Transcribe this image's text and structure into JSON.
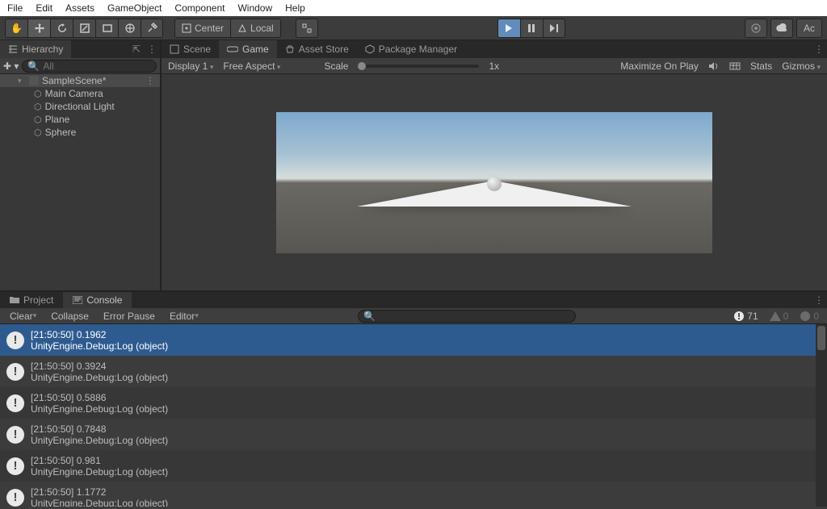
{
  "menubar": [
    "File",
    "Edit",
    "Assets",
    "GameObject",
    "Component",
    "Window",
    "Help"
  ],
  "toolbar": {
    "pivot": "Center",
    "handle": "Local",
    "account": "Ac"
  },
  "hierarchy": {
    "title": "Hierarchy",
    "search_placeholder": "All",
    "scene": "SampleScene*",
    "items": [
      "Main Camera",
      "Directional Light",
      "Plane",
      "Sphere"
    ]
  },
  "game_tabs": {
    "scene": "Scene",
    "game": "Game",
    "asset_store": "Asset Store",
    "package_manager": "Package Manager"
  },
  "game_bar": {
    "display": "Display 1",
    "aspect": "Free Aspect",
    "scale_label": "Scale",
    "scale_value": "1x",
    "maximize": "Maximize On Play",
    "stats": "Stats",
    "gizmos": "Gizmos"
  },
  "project_tabs": {
    "project": "Project",
    "console": "Console"
  },
  "console_bar": {
    "clear": "Clear",
    "collapse": "Collapse",
    "error_pause": "Error Pause",
    "editor": "Editor",
    "err_count": "71",
    "warn_count": "0",
    "info_count": "0"
  },
  "console_logs": [
    {
      "line1": "[21:50:50] 0.1962",
      "line2": "UnityEngine.Debug:Log (object)"
    },
    {
      "line1": "[21:50:50] 0.3924",
      "line2": "UnityEngine.Debug:Log (object)"
    },
    {
      "line1": "[21:50:50] 0.5886",
      "line2": "UnityEngine.Debug:Log (object)"
    },
    {
      "line1": "[21:50:50] 0.7848",
      "line2": "UnityEngine.Debug:Log (object)"
    },
    {
      "line1": "[21:50:50] 0.981",
      "line2": "UnityEngine.Debug:Log (object)"
    },
    {
      "line1": "[21:50:50] 1.1772",
      "line2": "UnityEngine.Debug:Log (object)"
    }
  ]
}
